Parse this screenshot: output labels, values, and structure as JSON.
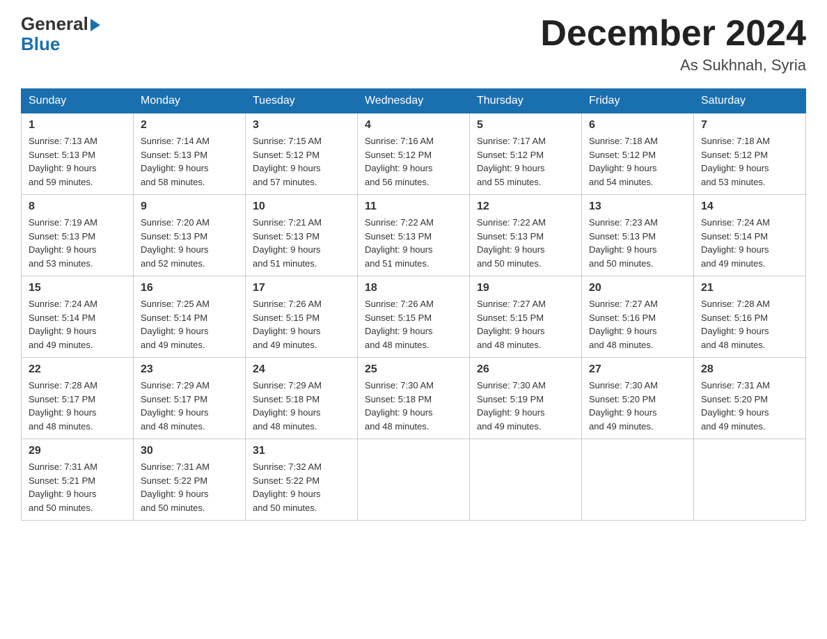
{
  "logo": {
    "general": "General",
    "blue": "Blue",
    "alt": "GeneralBlue logo"
  },
  "title": "December 2024",
  "subtitle": "As Sukhnah, Syria",
  "headers": [
    "Sunday",
    "Monday",
    "Tuesday",
    "Wednesday",
    "Thursday",
    "Friday",
    "Saturday"
  ],
  "weeks": [
    [
      {
        "day": "1",
        "sunrise": "7:13 AM",
        "sunset": "5:13 PM",
        "daylight": "9 hours and 59 minutes."
      },
      {
        "day": "2",
        "sunrise": "7:14 AM",
        "sunset": "5:13 PM",
        "daylight": "9 hours and 58 minutes."
      },
      {
        "day": "3",
        "sunrise": "7:15 AM",
        "sunset": "5:12 PM",
        "daylight": "9 hours and 57 minutes."
      },
      {
        "day": "4",
        "sunrise": "7:16 AM",
        "sunset": "5:12 PM",
        "daylight": "9 hours and 56 minutes."
      },
      {
        "day": "5",
        "sunrise": "7:17 AM",
        "sunset": "5:12 PM",
        "daylight": "9 hours and 55 minutes."
      },
      {
        "day": "6",
        "sunrise": "7:18 AM",
        "sunset": "5:12 PM",
        "daylight": "9 hours and 54 minutes."
      },
      {
        "day": "7",
        "sunrise": "7:18 AM",
        "sunset": "5:12 PM",
        "daylight": "9 hours and 53 minutes."
      }
    ],
    [
      {
        "day": "8",
        "sunrise": "7:19 AM",
        "sunset": "5:13 PM",
        "daylight": "9 hours and 53 minutes."
      },
      {
        "day": "9",
        "sunrise": "7:20 AM",
        "sunset": "5:13 PM",
        "daylight": "9 hours and 52 minutes."
      },
      {
        "day": "10",
        "sunrise": "7:21 AM",
        "sunset": "5:13 PM",
        "daylight": "9 hours and 51 minutes."
      },
      {
        "day": "11",
        "sunrise": "7:22 AM",
        "sunset": "5:13 PM",
        "daylight": "9 hours and 51 minutes."
      },
      {
        "day": "12",
        "sunrise": "7:22 AM",
        "sunset": "5:13 PM",
        "daylight": "9 hours and 50 minutes."
      },
      {
        "day": "13",
        "sunrise": "7:23 AM",
        "sunset": "5:13 PM",
        "daylight": "9 hours and 50 minutes."
      },
      {
        "day": "14",
        "sunrise": "7:24 AM",
        "sunset": "5:14 PM",
        "daylight": "9 hours and 49 minutes."
      }
    ],
    [
      {
        "day": "15",
        "sunrise": "7:24 AM",
        "sunset": "5:14 PM",
        "daylight": "9 hours and 49 minutes."
      },
      {
        "day": "16",
        "sunrise": "7:25 AM",
        "sunset": "5:14 PM",
        "daylight": "9 hours and 49 minutes."
      },
      {
        "day": "17",
        "sunrise": "7:26 AM",
        "sunset": "5:15 PM",
        "daylight": "9 hours and 49 minutes."
      },
      {
        "day": "18",
        "sunrise": "7:26 AM",
        "sunset": "5:15 PM",
        "daylight": "9 hours and 48 minutes."
      },
      {
        "day": "19",
        "sunrise": "7:27 AM",
        "sunset": "5:15 PM",
        "daylight": "9 hours and 48 minutes."
      },
      {
        "day": "20",
        "sunrise": "7:27 AM",
        "sunset": "5:16 PM",
        "daylight": "9 hours and 48 minutes."
      },
      {
        "day": "21",
        "sunrise": "7:28 AM",
        "sunset": "5:16 PM",
        "daylight": "9 hours and 48 minutes."
      }
    ],
    [
      {
        "day": "22",
        "sunrise": "7:28 AM",
        "sunset": "5:17 PM",
        "daylight": "9 hours and 48 minutes."
      },
      {
        "day": "23",
        "sunrise": "7:29 AM",
        "sunset": "5:17 PM",
        "daylight": "9 hours and 48 minutes."
      },
      {
        "day": "24",
        "sunrise": "7:29 AM",
        "sunset": "5:18 PM",
        "daylight": "9 hours and 48 minutes."
      },
      {
        "day": "25",
        "sunrise": "7:30 AM",
        "sunset": "5:18 PM",
        "daylight": "9 hours and 48 minutes."
      },
      {
        "day": "26",
        "sunrise": "7:30 AM",
        "sunset": "5:19 PM",
        "daylight": "9 hours and 49 minutes."
      },
      {
        "day": "27",
        "sunrise": "7:30 AM",
        "sunset": "5:20 PM",
        "daylight": "9 hours and 49 minutes."
      },
      {
        "day": "28",
        "sunrise": "7:31 AM",
        "sunset": "5:20 PM",
        "daylight": "9 hours and 49 minutes."
      }
    ],
    [
      {
        "day": "29",
        "sunrise": "7:31 AM",
        "sunset": "5:21 PM",
        "daylight": "9 hours and 50 minutes."
      },
      {
        "day": "30",
        "sunrise": "7:31 AM",
        "sunset": "5:22 PM",
        "daylight": "9 hours and 50 minutes."
      },
      {
        "day": "31",
        "sunrise": "7:32 AM",
        "sunset": "5:22 PM",
        "daylight": "9 hours and 50 minutes."
      },
      null,
      null,
      null,
      null
    ]
  ],
  "labels": {
    "sunrise": "Sunrise:",
    "sunset": "Sunset:",
    "daylight": "Daylight:"
  }
}
